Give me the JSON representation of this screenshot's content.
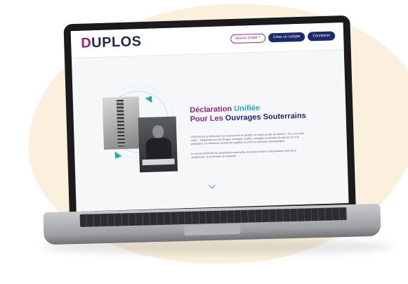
{
  "site": {
    "logo_first_letter": "D",
    "logo_rest": "UPLOS",
    "nav": {
      "help": "Besoin d'aide ?",
      "create_account": "Créer un compte",
      "login": "Connexion"
    }
  },
  "hero": {
    "title_line1_a": "Déclaration ",
    "title_line1_b": "Unifiée",
    "title_line2_a": "Pour Les ",
    "title_line2_b": "Ouvrages ",
    "title_line2_c": "Souterrains",
    "paragraph_1": "DUPLOS est un téléservice qui vous permet de déclarer un projet au titre de l'article L. 411-1 du Code minier : obligations pour les forages, sondages, fouilles, ouvrages souterrains de plus de 10 m de profondeur. Ce téléservice permet de simplifier et unifier la procédure administrative.",
    "paragraph_2": "Le service DUPLOS est actuellement accessible sur toute la France métropolitaine ainsi qu'en Guadeloupe, à La Réunion et à Mayotte."
  },
  "colors": {
    "brand_navy": "#1d2a6b",
    "brand_purple": "#8e2a7f",
    "brand_teal": "#2aa6b5"
  },
  "icons": {
    "scroll_down": "chevron-down-icon"
  }
}
